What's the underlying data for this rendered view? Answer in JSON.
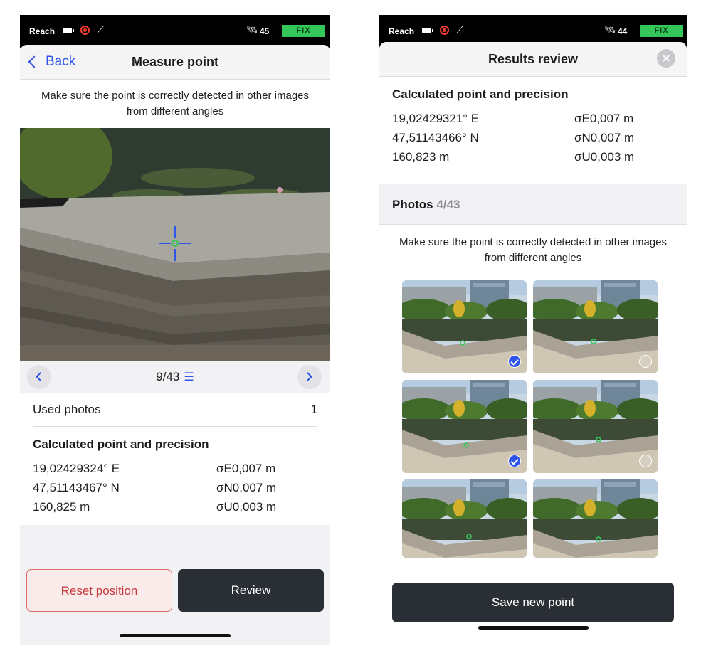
{
  "left": {
    "status": {
      "app": "Reach",
      "satellites": "45",
      "fix": "FIX"
    },
    "nav": {
      "back": "Back",
      "title": "Measure point"
    },
    "hint": "Make sure the point is correctly detected in other images from different angles",
    "pager": {
      "text": "9/43"
    },
    "used_photos": {
      "label": "Used photos",
      "value": "1"
    },
    "result": {
      "title": "Calculated point and precision",
      "lon": "19,02429324° E",
      "lat": "47,51143467° N",
      "alt": "160,825 m",
      "sigma_e": "σE0,007 m",
      "sigma_n": "σN0,007 m",
      "sigma_u": "σU0,003 m"
    },
    "buttons": {
      "reset": "Reset position",
      "review": "Review"
    }
  },
  "right": {
    "status": {
      "app": "Reach",
      "satellites": "44",
      "fix": "FIX"
    },
    "title": "Results review",
    "result": {
      "title": "Calculated point and precision",
      "lon": "19,02429321° E",
      "lat": "47,51143466° N",
      "alt": "160,823 m",
      "sigma_e": "σE0,007 m",
      "sigma_n": "σN0,007 m",
      "sigma_u": "σU0,003 m"
    },
    "photos": {
      "label": "Photos",
      "count": "4/43"
    },
    "hint": "Make sure the point is correctly detected in other images from different angles",
    "thumbnails": [
      {
        "state": "checked"
      },
      {
        "state": "pending"
      },
      {
        "state": "checked"
      },
      {
        "state": "pending"
      },
      {
        "state": "none"
      },
      {
        "state": "none"
      }
    ],
    "save": "Save new point"
  },
  "colors": {
    "accent": "#2f54eb",
    "fix_green": "#34c759",
    "danger": "#c4393b",
    "dark_button": "#2a2f35"
  },
  "icons": [
    "battery-icon",
    "record-icon",
    "tilt-icon",
    "satellite-icon",
    "chevron-left-icon",
    "chevron-right-icon",
    "list-icon",
    "close-icon",
    "check-icon",
    "pending-icon",
    "crosshair-icon"
  ]
}
